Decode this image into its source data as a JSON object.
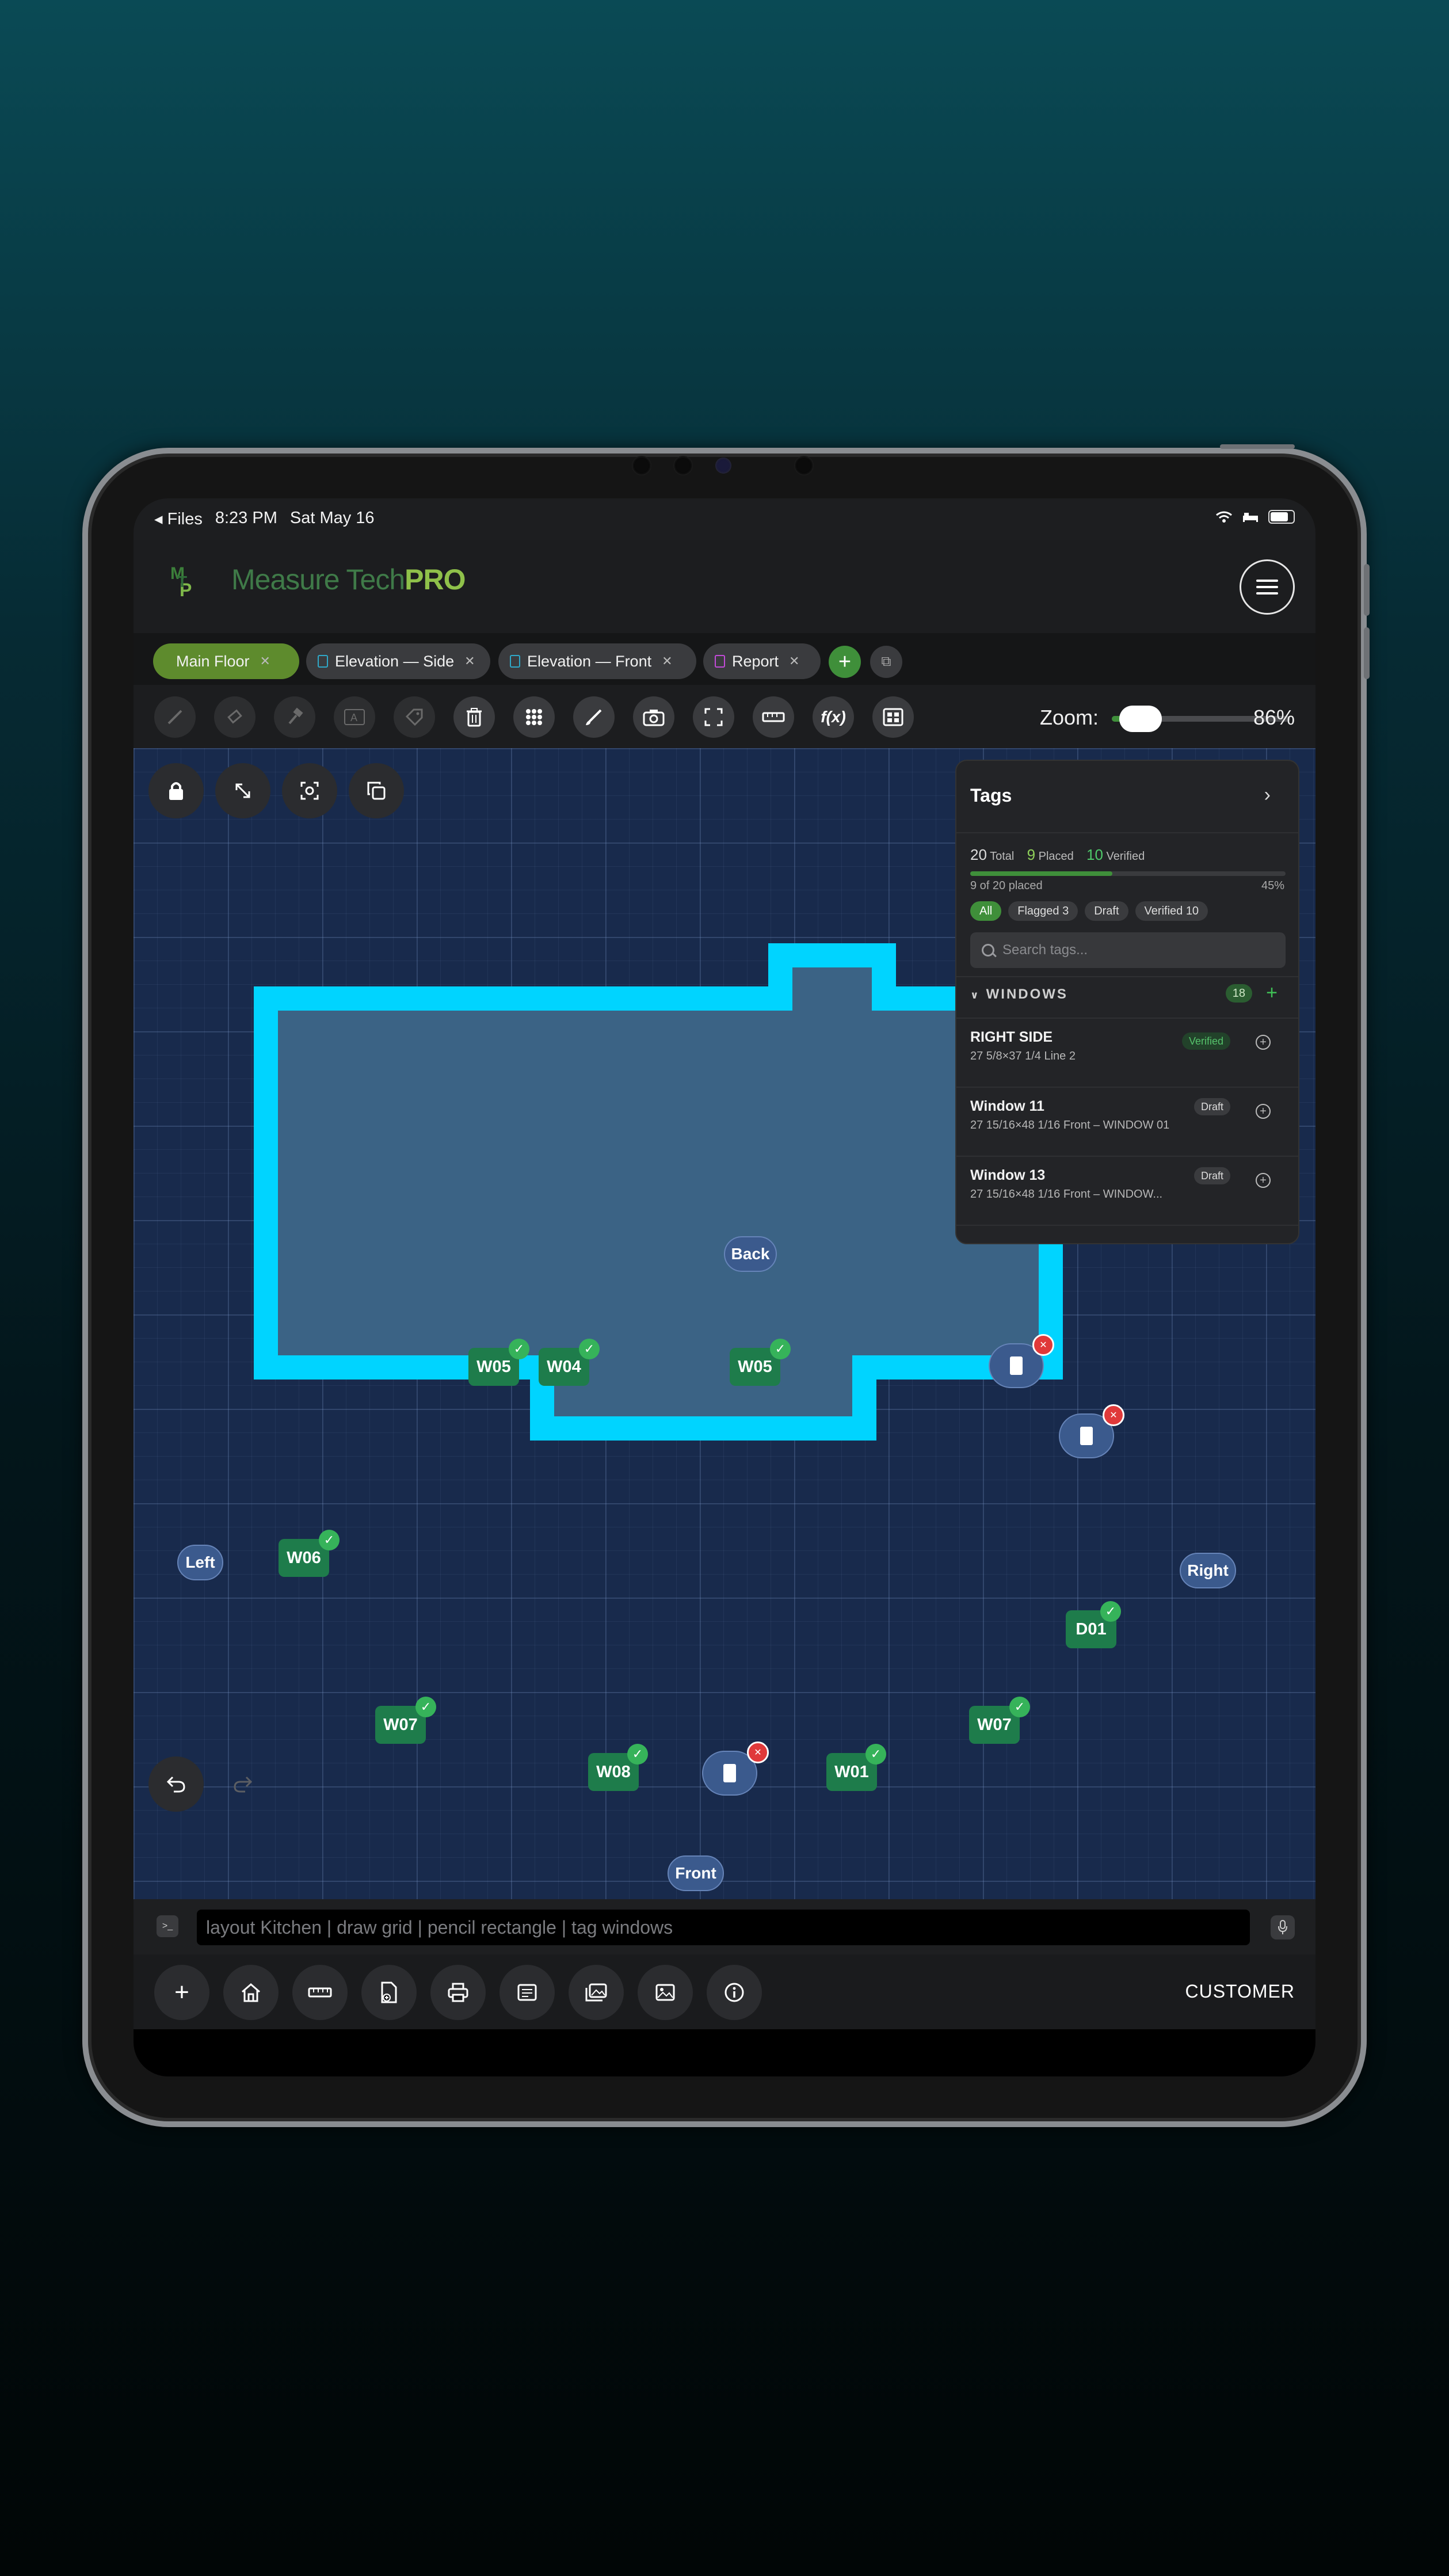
{
  "status_bar": {
    "back_app": "Files",
    "time": "8:23 PM",
    "date": "Sat May 16"
  },
  "app": {
    "logo_text": "MTP",
    "brand_name": "Measure Tech",
    "brand_suffix": "PRO",
    "brand_color": "#3f7a48",
    "accent_color": "#3f8f3a"
  },
  "tabs": [
    {
      "label": "Main Floor",
      "active": true
    },
    {
      "label": "Elevation — Side",
      "active": false
    },
    {
      "label": "Elevation — Front",
      "active": false
    },
    {
      "label": "Report",
      "active": false
    }
  ],
  "toolbar": {
    "tools": [
      "pencil-icon",
      "eraser-icon",
      "hammer-icon",
      "text-box-icon",
      "tag-icon",
      "trash-icon",
      "grid-icon",
      "brush-icon",
      "camera-icon",
      "frame-icon",
      "ruler-icon",
      "function-icon",
      "scan-icon"
    ],
    "function_label": "f(x)",
    "zoom_label": "Zoom:",
    "zoom_value": "86%",
    "zoom_level": 0.86
  },
  "canvas": {
    "side_labels": {
      "back": "Back",
      "left": "Left",
      "right": "Right",
      "front": "Front"
    },
    "wall_color": "#00d4ff",
    "room_color": "#3b6385",
    "tags": {
      "w05a": "W05",
      "w04": "W04",
      "w05b": "W05",
      "w06": "W06",
      "d01": "D01",
      "w07a": "W07",
      "w07b": "W07",
      "w08": "W08",
      "w01": "W01"
    }
  },
  "tags_panel": {
    "title": "Tags",
    "total": "20",
    "total_label": "Total",
    "placed": "9",
    "placed_label": "Placed",
    "verified": "10",
    "verified_label": "Verified",
    "progress_text": "9 of 20 placed",
    "progress_pct": "45%",
    "progress_fraction": 0.45,
    "chips": [
      "All",
      "Flagged 3",
      "Draft",
      "Verified 10"
    ],
    "search_placeholder": "Search tags...",
    "section_title": "WINDOWS",
    "section_count": "18",
    "rows": [
      {
        "title": "RIGHT SIDE",
        "sub": "27 5/8×37 1/4   Line 2",
        "badge": "Verified"
      },
      {
        "title": "Window 11",
        "sub": "27 15/16×48 1/16   Front – WINDOW 01",
        "badge": "Draft"
      },
      {
        "title": "Window 13",
        "sub": "27 15/16×48 1/16   Front – WINDOW...",
        "badge": "Draft"
      }
    ]
  },
  "command": {
    "value": "layout Kitchen | draw grid | pencil rectangle | tag windows"
  },
  "bottom_bar": {
    "buttons": [
      "add-icon",
      "home-icon",
      "ruler-icon",
      "file-add-icon",
      "print-icon",
      "document-icon",
      "gallery-icon",
      "photo-icon",
      "info-icon"
    ],
    "customer_label": "CUSTOMER"
  }
}
